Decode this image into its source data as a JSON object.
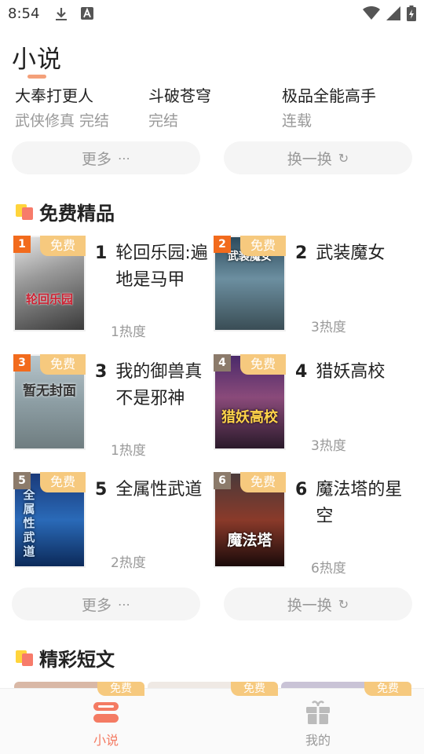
{
  "status_bar": {
    "time": "8:54",
    "icons": [
      "download-icon",
      "font-icon",
      "wifi-icon",
      "signal-icon",
      "battery-charging-icon"
    ]
  },
  "page_title": "小说",
  "top_novels": [
    {
      "name": "大奉打更人",
      "meta": "武侠修真 完结"
    },
    {
      "name": "斗破苍穹",
      "meta": "完结"
    },
    {
      "name": "极品全能高手",
      "meta": "连载"
    }
  ],
  "actions": {
    "more_label": "更多",
    "more_icon": "⋯",
    "refresh_label": "换一换",
    "refresh_icon": "↻"
  },
  "sections": {
    "free_title": "免费精品",
    "short_title": "精彩短文"
  },
  "free_badge": "免费",
  "books": [
    {
      "rank": "1",
      "title_rank": "1",
      "title": "轮回乐园:遍地是马甲",
      "heat": "1热度",
      "cover_text": "轮回乐园"
    },
    {
      "rank": "2",
      "title_rank": "2",
      "title": "武装魔女",
      "heat": "3热度",
      "cover_text": "武装魔女"
    },
    {
      "rank": "3",
      "title_rank": "3",
      "title": "我的御兽真不是邪神",
      "heat": "1热度",
      "cover_text": "暂无封面"
    },
    {
      "rank": "4",
      "title_rank": "4",
      "title": "猎妖高校",
      "heat": "3热度",
      "cover_text": "猎妖高校"
    },
    {
      "rank": "5",
      "title_rank": "5",
      "title": "全属性武道",
      "heat": "2热度",
      "cover_text": "全属性武道"
    },
    {
      "rank": "6",
      "title_rank": "6",
      "title": "魔法塔的星空",
      "heat": "6热度",
      "cover_text": "魔法塔"
    }
  ],
  "bottom_nav": [
    {
      "label": "小说",
      "icon": "book-icon",
      "active": true
    },
    {
      "label": "我的",
      "icon": "gift-icon",
      "active": false
    }
  ],
  "colors": {
    "accent": "#f4a07a",
    "active_nav": "#f47b63",
    "rank_badge": "#f26b1d",
    "free_badge": "#f6c97e",
    "muted_text": "#999999"
  }
}
